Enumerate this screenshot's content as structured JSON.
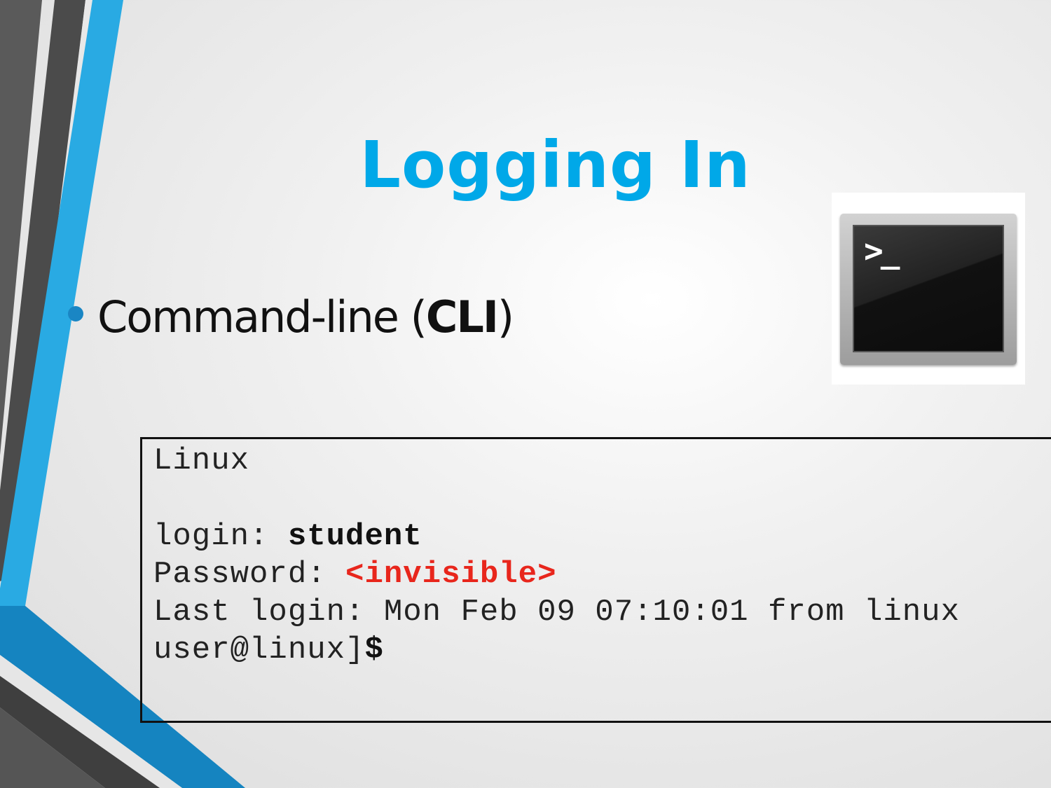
{
  "slide": {
    "title": "Logging In",
    "bullet": {
      "text_regular": "Command-line (",
      "text_bold": "CLI",
      "text_close": ")"
    },
    "terminal_icon": {
      "prompt": ">_",
      "icon": "terminal-icon"
    },
    "console": {
      "line1": "Linux",
      "login_label": "login: ",
      "login_value": "student",
      "password_label": "Password: ",
      "password_value": "<invisible>",
      "last_login": "Last login: Mon Feb 09 07:10:01 from linux",
      "prompt_text": "user@linux]",
      "prompt_symbol": "$"
    },
    "colors": {
      "accent": "#00a8e8",
      "decor_blue": "#29aae3",
      "decor_dark": "#4a4a4a",
      "highlight_red": "#e8261c"
    }
  }
}
